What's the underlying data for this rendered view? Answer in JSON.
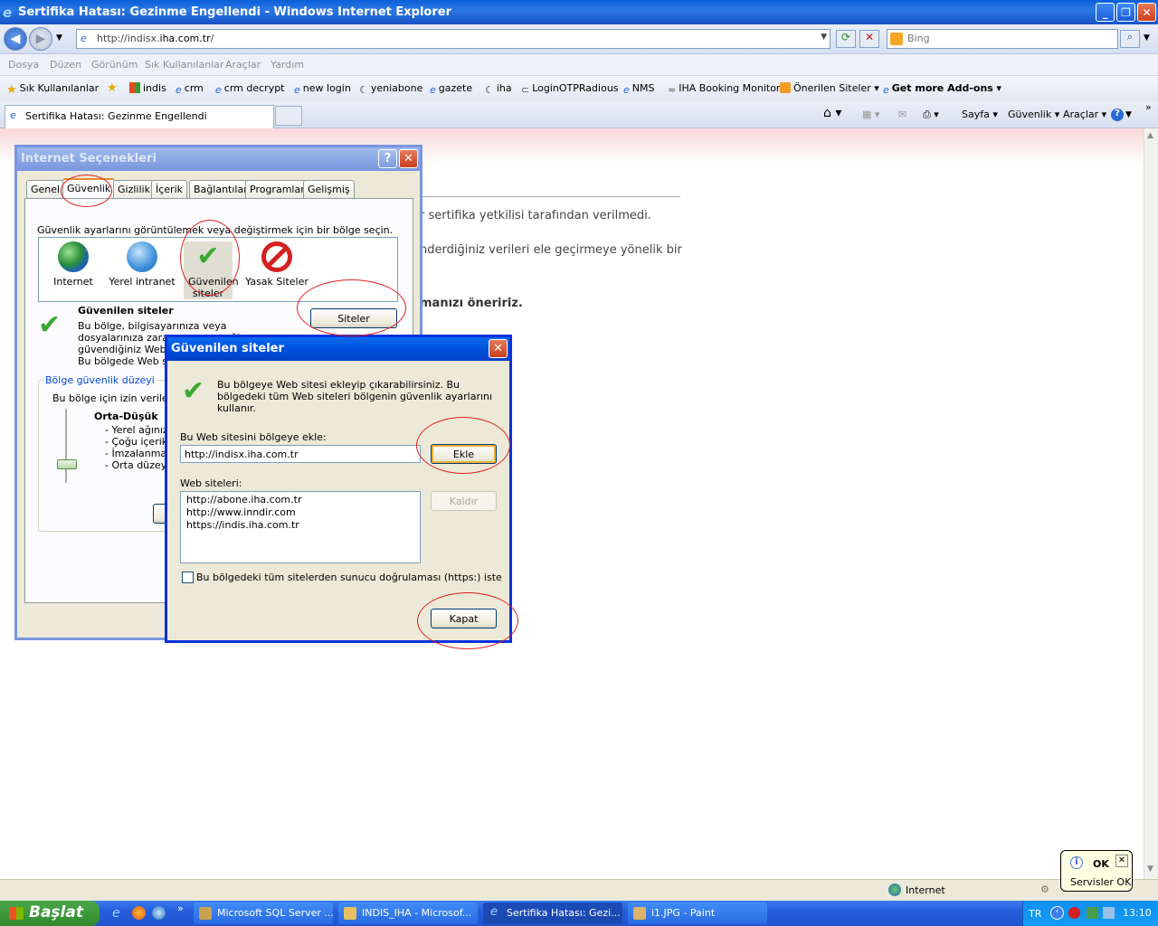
{
  "window": {
    "title": "Sertifika Hatası: Gezinme Engellendi - Windows Internet Explorer"
  },
  "address": {
    "url_prefix": "http://indisx.",
    "url_domain": "iha.com.tr",
    "url_suffix": "/",
    "search_placeholder": "Bing"
  },
  "menu": [
    "Dosya",
    "Düzen",
    "Görünüm",
    "Sık Kullanılanlar",
    "Araçlar",
    "Yardım"
  ],
  "favorites": {
    "label": "Sık Kullanılanlar",
    "items": [
      "indis",
      "crm",
      "crm decrypt",
      "new login",
      "yeniabone",
      "gazete",
      "iha",
      "LoginOTPRadious",
      "NMS",
      "IHA Booking Monitor",
      "Önerilen Siteler",
      "Get more Add-ons"
    ]
  },
  "tab": {
    "title": "Sertifika Hatası: Gezinme Engellendi"
  },
  "commandbar": {
    "sayfa": "Sayfa",
    "guvenlik": "Güvenlik",
    "araclar": "Araçlar"
  },
  "page": {
    "line1": "r sertifika yetkilisi tarafından verilmedi.",
    "line2": "nderdiğiniz verileri ele geçirmeye yönelik bir",
    "line3": "manızı öneririz."
  },
  "internet_options": {
    "title": "Internet Seçenekleri",
    "tabs": [
      "Genel",
      "Güvenlik",
      "Gizlilik",
      "İçerik",
      "Bağlantılar",
      "Programlar",
      "Gelişmiş"
    ],
    "instruction": "Güvenlik ayarlarını görüntülemek veya değiştirmek için bir bölge seçin.",
    "zones": [
      "Internet",
      "Yerel intranet",
      "Güvenilen siteler",
      "Yasak Siteler"
    ],
    "zone_name": "Güvenilen siteler",
    "zone_desc": [
      "Bu bölge, bilgisayarınıza veya",
      "dosyalarınıza zarar vermeyeceğine",
      "güvendiğiniz Web site",
      "Bu bölgede Web site"
    ],
    "sites_button": "Siteler",
    "level_group": "Bölge güvenlik düzeyi",
    "level_intro": "Bu bölge için izin verilen d",
    "level_name": "Orta-Düşük",
    "level_items": [
      "- Yerel ağınızd",
      "- Çoğu içerik s",
      "- İmzalanmam",
      "- Orta düzey i"
    ]
  },
  "trusted_sites": {
    "title": "Güvenilen siteler",
    "info": "Bu bölgeye Web sitesi ekleyip çıkarabilirsiniz. Bu bölgedeki tüm Web siteleri bölgenin güvenlik ayarlarını kullanır.",
    "add_label": "Bu Web sitesini bölgeye ekle:",
    "add_value": "http://indisx.iha.com.tr",
    "add_button": "Ekle",
    "list_label": "Web siteleri:",
    "sites": [
      "http://abone.iha.com.tr",
      "http://www.inndir.com",
      "https://indis.iha.com.tr"
    ],
    "remove_button": "Kaldır",
    "https_check": "Bu bölgedeki tüm sitelerden sunucu doğrulaması (https:) iste",
    "close_button": "Kapat"
  },
  "statusbar": {
    "zone": "Internet"
  },
  "taskbar": {
    "start": "Başlat",
    "tasks": [
      "Microsoft SQL Server ...",
      "INDIS_IHA - Microsof...",
      "Sertifika Hatası: Gezi...",
      "i1.JPG - Paint"
    ],
    "lang": "TR",
    "clock": "13:10"
  },
  "balloon": {
    "title": "OK",
    "text": "Servisler OK"
  },
  "colors": {
    "xp_blue": "#0831d9",
    "annotation_red": "#e0201e"
  }
}
